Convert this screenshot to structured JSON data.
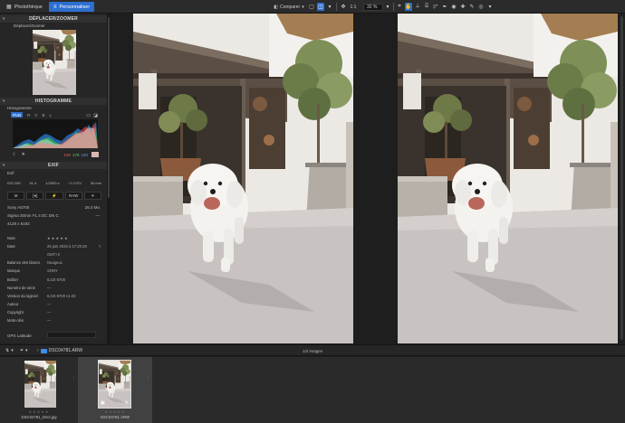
{
  "topbar": {
    "tab_library": "Photothèque",
    "tab_customize": "Personnaliser",
    "compare_label": "Comparer",
    "ratio_label": "1:1",
    "zoom_value": "32 %"
  },
  "sidebar": {
    "navigator": {
      "title": "DÉPLACER/ZOOMER",
      "sub": "Déplacer/Zoomer"
    },
    "histogram": {
      "title": "HISTOGRAMME",
      "sub": "Histogramme",
      "channels": [
        "RVB",
        "R",
        "V",
        "B",
        "L"
      ],
      "values": {
        "r": "195",
        "g": "178",
        "b": "180"
      }
    },
    "exif": {
      "title": "EXIF",
      "sub": "Exif",
      "settings": [
        "ISO 250",
        "f/1.4",
        "1/2000 s",
        "+1.0 EV",
        "30 mm"
      ],
      "tool_cells": [
        "M",
        "[●]",
        "⚡",
        "RAW",
        "☀"
      ],
      "camera": "Sony A6700",
      "megapixels": "26.0 Mo",
      "lens": "Sigma 30mm F1.4 DC DN C",
      "lens_value": "—",
      "dimensions": "4128 x 6192"
    },
    "metadata": [
      {
        "key": "Note",
        "value": "★★★★★",
        "stars": true
      },
      {
        "key": "Date",
        "value": "25 juin 2025 à 17:20:26",
        "extra": "✎"
      },
      {
        "key": "",
        "value": "GMT+2"
      },
      {
        "key": "Balance des blancs",
        "value": "Nuageux"
      },
      {
        "key": "Marque",
        "value": "SONY"
      },
      {
        "key": "Boîtier",
        "value": "ILCE-6700"
      },
      {
        "key": "Numéro de série",
        "value": "—"
      },
      {
        "key": "Version du logiciel",
        "value": "ILCE-6700 v1.03"
      },
      {
        "key": "Auteur",
        "value": "—"
      },
      {
        "key": "Copyright",
        "value": "—"
      },
      {
        "key": "Mots-clés",
        "value": "—"
      }
    ],
    "gps_label": "GPS Latitude"
  },
  "stripbar": {
    "filename": "DSC04781.ARW",
    "count": "1/2 images"
  },
  "filmstrip": [
    {
      "name": "DSC04781_DxO.jpg",
      "stars": "★★★★★"
    },
    {
      "name": "DSC04781.ARW",
      "stars": "★★★★★"
    }
  ],
  "colors": {
    "accent": "#2d6fd1",
    "folder": "#3d8ee8",
    "swatch": "#d9b8b4"
  }
}
